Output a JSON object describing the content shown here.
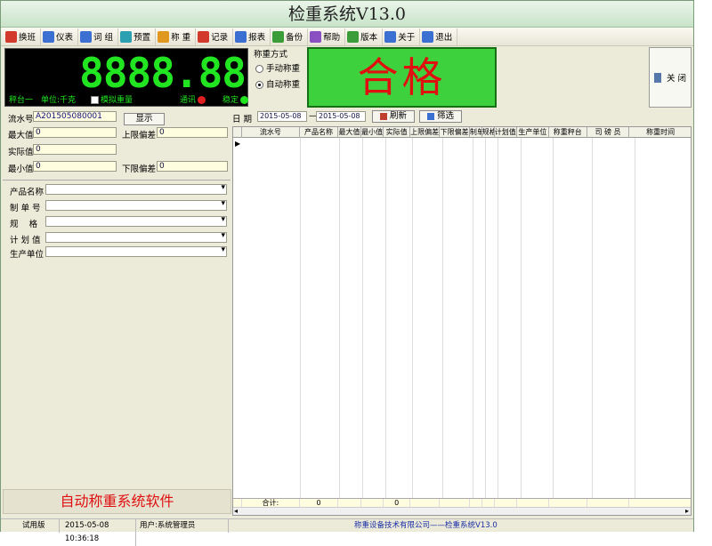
{
  "window": {
    "title": "检重系统V13.0"
  },
  "toolbar": [
    {
      "label": "换班",
      "icon": "shift-icon",
      "color": "red"
    },
    {
      "label": "仪表",
      "icon": "meter-icon",
      "color": "blu"
    },
    {
      "label": "词 组",
      "icon": "edit-icon",
      "color": "blu"
    },
    {
      "label": "预置",
      "icon": "preset-icon",
      "color": "cyan"
    },
    {
      "label": "称 重",
      "icon": "weigh-icon",
      "color": "org"
    },
    {
      "label": "记录",
      "icon": "record-icon",
      "color": "red"
    },
    {
      "label": "报表",
      "icon": "report-icon",
      "color": "blu"
    },
    {
      "label": "备份",
      "icon": "backup-icon",
      "color": "grn"
    },
    {
      "label": "帮助",
      "icon": "help-icon",
      "color": "pur"
    },
    {
      "label": "版本",
      "icon": "version-icon",
      "color": "grn"
    },
    {
      "label": "关于",
      "icon": "about-icon",
      "color": "blu"
    },
    {
      "label": "退出",
      "icon": "exit-icon",
      "color": "blu"
    }
  ],
  "display": {
    "value": "8888.88",
    "platform": "秤台一",
    "unit": "单位:千克",
    "simulate": "模拟重量",
    "comm": "通讯",
    "stable": "稳定"
  },
  "mode": {
    "title": "称重方式",
    "manual": "手动称重",
    "auto": "自动称重"
  },
  "result": "合格",
  "close_label": "关 闭",
  "form": {
    "serial_label": "流水号",
    "serial_value": "A201505080001",
    "show_button": "显示",
    "max_label": "最大值",
    "max_value": "0",
    "upper_label": "上限偏差",
    "upper_value": "0",
    "actual_label": "实际值",
    "actual_value": "0",
    "min_label": "最小值",
    "min_value": "0",
    "lower_label": "下限偏差",
    "lower_value": "0",
    "product_label": "产品名称",
    "order_label": "制 单 号",
    "spec_label": "规    格",
    "plan_label": "计 划 值",
    "unit_label": "生产单位"
  },
  "software_name": "自动称重系统软件",
  "filter": {
    "date_label": "日 期",
    "date_from": "2015-05-08",
    "date_sep": "—",
    "date_to": "2015-05-08",
    "refresh": "刷新",
    "filter": "筛选"
  },
  "grid": {
    "columns": [
      "流水号",
      "产品名称",
      "最大值",
      "最小值",
      "实际值",
      "上限偏差",
      "下限偏差",
      "制单号",
      "规格",
      "计划值",
      "生产单位",
      "称重秤台",
      "司 磅 员",
      "称重时间"
    ],
    "footer_label": "合计:",
    "footer_count": "0",
    "footer_actual": "0"
  },
  "status": {
    "mode": "试用版",
    "datetime": "2015-05-08 10:36:18",
    "user": "用户:系统管理员",
    "company": "称重设备技术有限公司——检重系统V13.0"
  }
}
